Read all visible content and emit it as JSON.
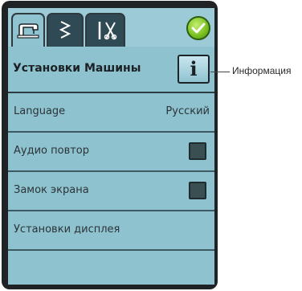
{
  "tabs": [
    {
      "icon": "sewing-machine-icon",
      "active": true
    },
    {
      "icon": "zigzag-stitch-icon",
      "active": false
    },
    {
      "icon": "tools-icon",
      "active": false
    }
  ],
  "ok_icon": "checkmark-icon",
  "title": "Установки Машины",
  "info_icon": "info-icon",
  "info_glyph": "i",
  "rows": {
    "language": {
      "label": "Language",
      "value": "Русский"
    },
    "audio": {
      "label": "Аудио повтор",
      "checked": false
    },
    "lock": {
      "label": "Замок экрана",
      "checked": false
    },
    "display": {
      "label": "Установки дисплея"
    }
  },
  "callout": "Информация",
  "colors": {
    "screen": "#8ec2cf",
    "tab_inactive": "#2f4a55",
    "ok": "#7ec423",
    "frame": "#1f2326"
  }
}
